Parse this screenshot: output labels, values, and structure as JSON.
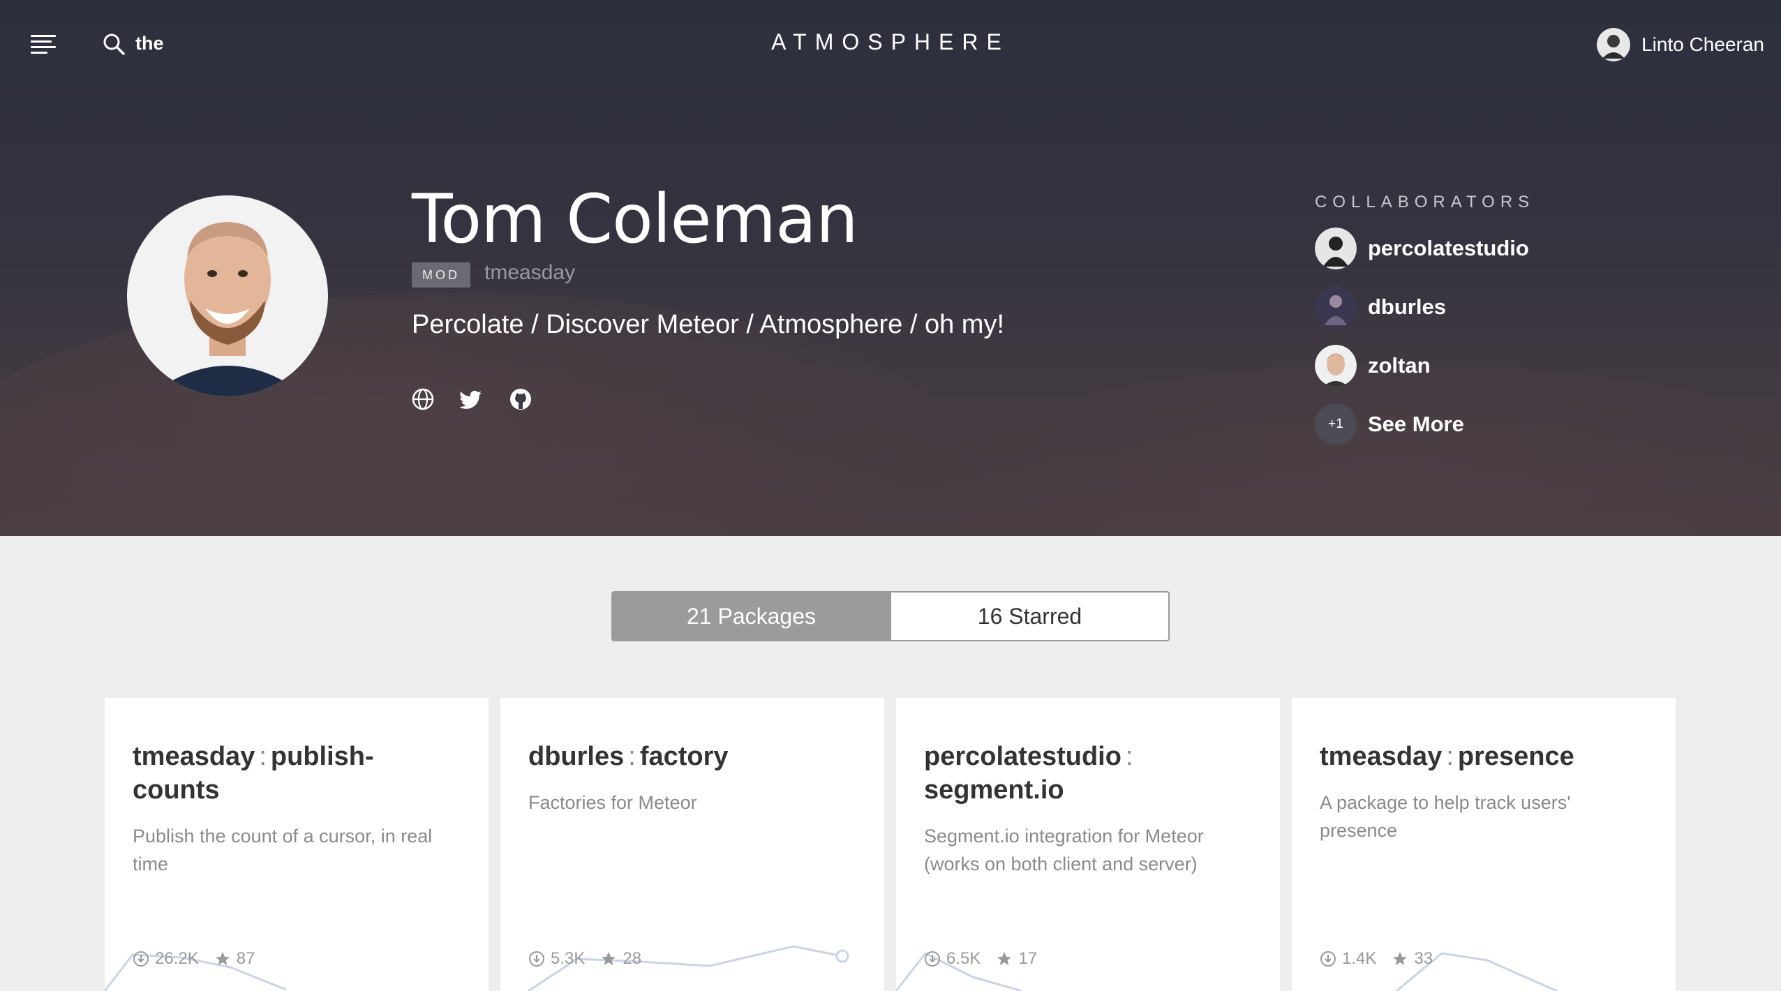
{
  "header": {
    "brand": "ATMOSPHERE",
    "search_value": "the",
    "user_name": "Linto Cheeran"
  },
  "profile": {
    "name": "Tom Coleman",
    "badge": "MOD",
    "username": "tmeasday",
    "bio": "Percolate / Discover Meteor / Atmosphere / oh my!",
    "social_icons": [
      "globe-icon",
      "twitter-icon",
      "github-icon"
    ]
  },
  "collaborators": {
    "title": "COLLABORATORS",
    "items": [
      {
        "name": "percolatestudio"
      },
      {
        "name": "dburles"
      },
      {
        "name": "zoltan"
      }
    ],
    "more_badge": "+1",
    "more_label": "See More"
  },
  "tabs": {
    "packages": "21 Packages",
    "starred": "16 Starred",
    "active": "packages"
  },
  "cards": [
    {
      "author": "tmeasday",
      "sep": ":",
      "pkg": "publish-counts",
      "desc": "Publish the count of a cursor, in real time",
      "downloads": "26.2K",
      "stars": "87"
    },
    {
      "author": "dburles",
      "sep": ":",
      "pkg": "factory",
      "desc": "Factories for Meteor",
      "downloads": "5.3K",
      "stars": "28"
    },
    {
      "author": "percolatestudio",
      "sep": ":",
      "pkg": "segment.io",
      "desc": "Segment.io integration for Meteor (works on both client and server)",
      "downloads": "6.5K",
      "stars": "17"
    },
    {
      "author": "tmeasday",
      "sep": ":",
      "pkg": "presence",
      "desc": "A package to help track users' presence",
      "downloads": "1.4K",
      "stars": "33"
    }
  ],
  "colors": {
    "hero_top": "#2c2f3d",
    "hero_bottom": "#4a3e43",
    "page_bg": "#eeeeee",
    "tab_active": "#9b9b9b",
    "sparkline": "#c8d4e8"
  }
}
